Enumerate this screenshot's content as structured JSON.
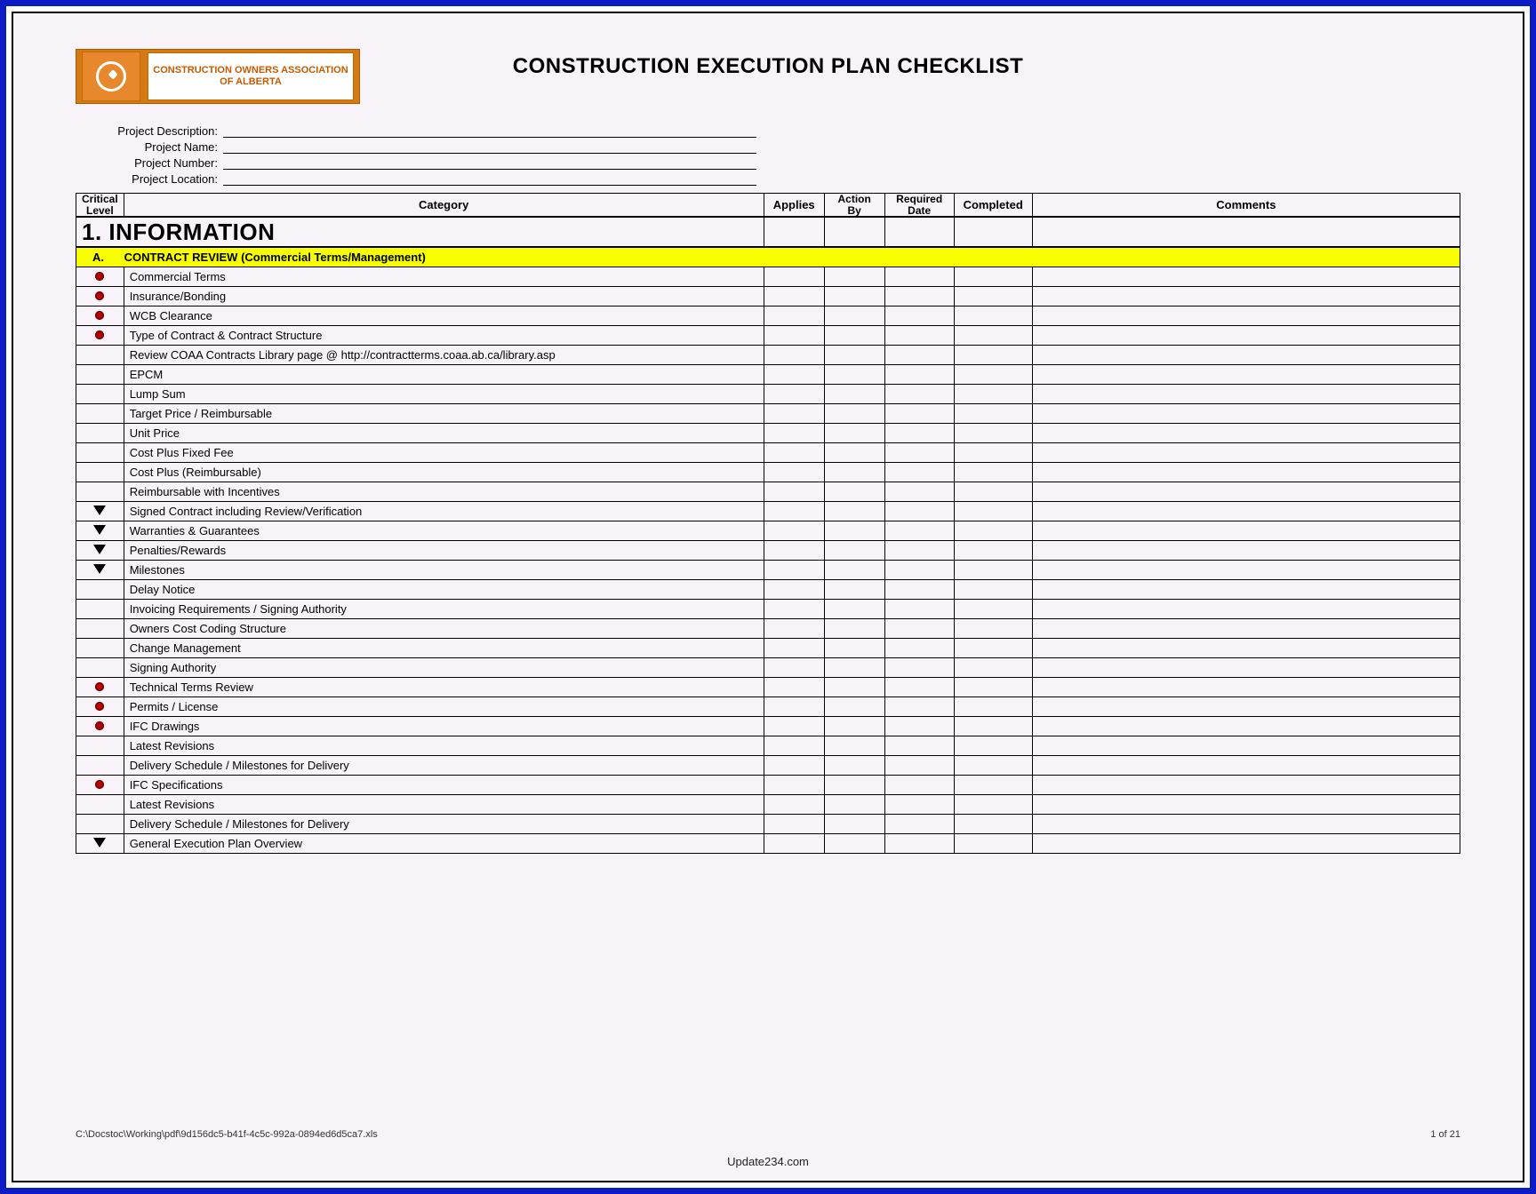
{
  "logo_text": "CONSTRUCTION OWNERS ASSOCIATION OF ALBERTA",
  "title": "CONSTRUCTION EXECUTION PLAN CHECKLIST",
  "meta_labels": {
    "desc": "Project Description:",
    "name": "Project Name:",
    "number": "Project Number:",
    "location": "Project Location:"
  },
  "columns": {
    "critical": "Critical Level",
    "category": "Category",
    "applies": "Applies",
    "action_by": "Action By",
    "required_date": "Required Date",
    "completed": "Completed",
    "comments": "Comments"
  },
  "section_number_title": "1. INFORMATION",
  "subsection_letter": "A.",
  "subsection_title": "CONTRACT REVIEW (Commercial Terms/Management)",
  "rows": [
    {
      "crit": "dot",
      "indent": 1,
      "text": "Commercial Terms"
    },
    {
      "crit": "dot",
      "indent": 2,
      "text": "Insurance/Bonding"
    },
    {
      "crit": "dot",
      "indent": 2,
      "text": "WCB Clearance"
    },
    {
      "crit": "dot",
      "indent": 2,
      "text": "Type of Contract & Contract Structure"
    },
    {
      "crit": "",
      "indent": 3,
      "text": "Review COAA Contracts Library page @ http://contractterms.coaa.ab.ca/library.asp"
    },
    {
      "crit": "",
      "indent": 3,
      "text": "EPCM"
    },
    {
      "crit": "",
      "indent": 3,
      "text": "Lump Sum"
    },
    {
      "crit": "",
      "indent": 3,
      "text": "Target Price / Reimbursable"
    },
    {
      "crit": "",
      "indent": 3,
      "text": "Unit Price"
    },
    {
      "crit": "",
      "indent": 3,
      "text": "Cost Plus Fixed Fee"
    },
    {
      "crit": "",
      "indent": 3,
      "text": "Cost Plus (Reimbursable)"
    },
    {
      "crit": "",
      "indent": 3,
      "text": "Reimbursable with Incentives"
    },
    {
      "crit": "tri",
      "indent": 2,
      "text": "Signed Contract including Review/Verification"
    },
    {
      "crit": "tri",
      "indent": 2,
      "text": "Warranties & Guarantees"
    },
    {
      "crit": "tri",
      "indent": 2,
      "text": "Penalties/Rewards"
    },
    {
      "crit": "tri",
      "indent": 2,
      "text": "Milestones"
    },
    {
      "crit": "",
      "indent": 2,
      "text": "Delay Notice"
    },
    {
      "crit": "",
      "indent": 2,
      "text": "Invoicing Requirements / Signing Authority"
    },
    {
      "crit": "",
      "indent": 2,
      "text": "Owners Cost Coding Structure"
    },
    {
      "crit": "",
      "indent": 2,
      "text": "Change Management"
    },
    {
      "crit": "",
      "indent": 2,
      "text": "Signing Authority"
    },
    {
      "crit": "dot",
      "indent": 1,
      "text": "Technical Terms Review"
    },
    {
      "crit": "dot",
      "indent": 2,
      "text": "Permits / License"
    },
    {
      "crit": "dot",
      "indent": 2,
      "text": "IFC Drawings"
    },
    {
      "crit": "",
      "indent": 3,
      "text": "Latest Revisions"
    },
    {
      "crit": "",
      "indent": 3,
      "text": "Delivery Schedule / Milestones for Delivery"
    },
    {
      "crit": "dot",
      "indent": 2,
      "text": "IFC Specifications"
    },
    {
      "crit": "",
      "indent": 3,
      "text": "Latest Revisions"
    },
    {
      "crit": "",
      "indent": 3,
      "text": "Delivery Schedule / Milestones for Delivery"
    },
    {
      "crit": "tri",
      "indent": 2,
      "text": "General Execution Plan Overview"
    }
  ],
  "footer_path": "C:\\Docstoc\\Working\\pdf\\9d156dc5-b41f-4c5c-992a-0894ed6d5ca7.xls",
  "footer_page": "1 of 21",
  "credit": "Update234.com"
}
